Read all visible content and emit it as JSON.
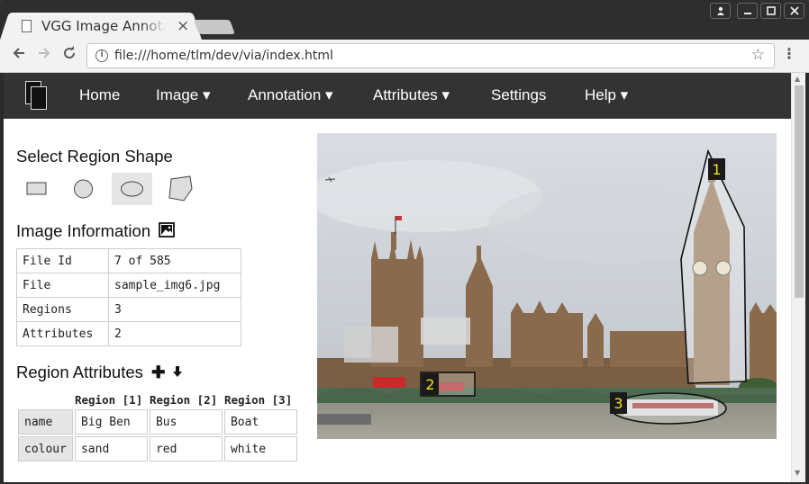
{
  "browser": {
    "tab_title": "VGG Image Annotator",
    "url": "file:///home/tlm/dev/via/index.html"
  },
  "navbar": {
    "items": [
      {
        "label": "Home"
      },
      {
        "label": "Image ▾"
      },
      {
        "label": "Annotation ▾"
      },
      {
        "label": "Attributes ▾"
      },
      {
        "label": "Settings"
      },
      {
        "label": "Help ▾"
      }
    ]
  },
  "sidebar": {
    "shape_heading": "Select Region Shape",
    "shapes": [
      "rectangle",
      "circle",
      "ellipse",
      "polygon"
    ],
    "selected_shape": "ellipse",
    "info_heading": "Image Information",
    "info_rows": [
      {
        "key": "File Id",
        "value": "7 of 585"
      },
      {
        "key": "File",
        "value": "sample_img6.jpg"
      },
      {
        "key": "Regions",
        "value": "3"
      },
      {
        "key": "Attributes",
        "value": "2"
      }
    ],
    "attr_heading": "Region Attributes",
    "attr_columns": [
      "Region [1]",
      "Region [2]",
      "Region [3]"
    ],
    "attr_rows": [
      {
        "name": "name",
        "values": [
          "Big Ben",
          "Bus",
          "Boat"
        ]
      },
      {
        "name": "colour",
        "values": [
          "sand",
          "red",
          "white"
        ]
      }
    ]
  },
  "canvas": {
    "region_labels": [
      "1",
      "2",
      "3"
    ]
  }
}
